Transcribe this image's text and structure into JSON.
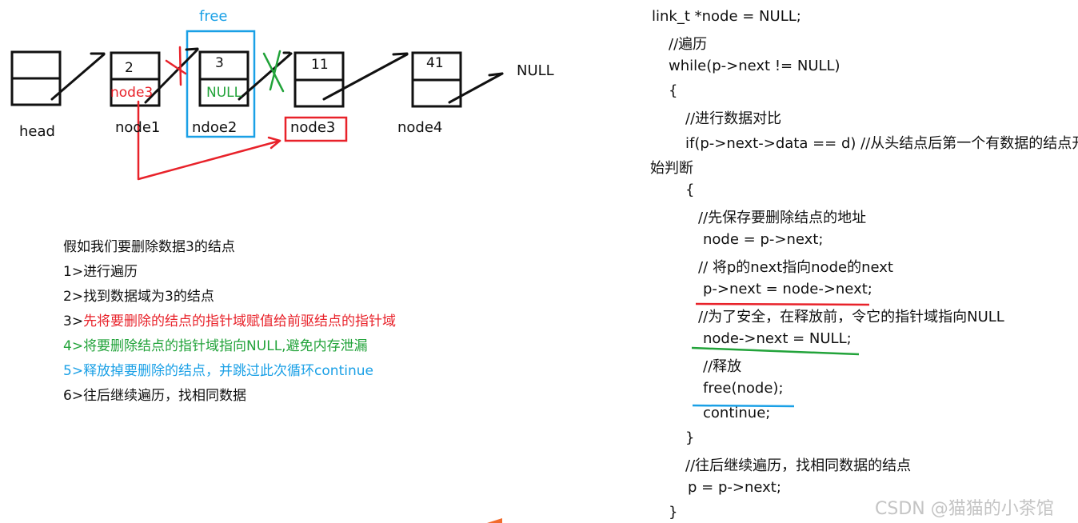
{
  "diagram": {
    "free_label": "free",
    "null_end_label": "NULL",
    "nodes": [
      {
        "name": "head",
        "data": "",
        "next_text": ""
      },
      {
        "name": "node1",
        "data": "2",
        "next_text": "node3"
      },
      {
        "name": "ndoe2",
        "data": "3",
        "next_text": "NULL"
      },
      {
        "name": "node3",
        "data": "11",
        "next_text": ""
      },
      {
        "name": "node4",
        "data": "41",
        "next_text": ""
      }
    ],
    "colors": {
      "red": "#e8222a",
      "green": "#22a33a",
      "blue": "#1aa0e6",
      "black": "#111111",
      "orange": "#f26b2c"
    }
  },
  "steps": {
    "intro": "假如我们要删除数据3的结点",
    "items": [
      {
        "prefix": "1>",
        "text": "进行遍历",
        "color": "black"
      },
      {
        "prefix": "2>",
        "text": "找到数据域为3的结点",
        "color": "black"
      },
      {
        "prefix": "3>",
        "text": "先将要删除的结点的指针域赋值给前驱结点的指针域",
        "color": "red"
      },
      {
        "prefix": "4>",
        "text": "将要删除结点的指针域指向NULL,避免内存泄漏",
        "color": "green"
      },
      {
        "prefix": "5>",
        "text": "释放掉要删除的结点，并跳过此次循环continue",
        "color": "blue"
      },
      {
        "prefix": "6>",
        "text": "往后继续遍历，找相同数据",
        "color": "black"
      }
    ]
  },
  "code": {
    "lines": [
      " link_t *node = NULL;",
      "//遍历",
      "while(p->next != NULL)",
      "{",
      "//进行数据对比",
      "if(p->next->data == d) //从头结点后第一个有数据的结点开",
      "始判断",
      "{",
      "//先保存要删除结点的地址",
      "node = p->next;",
      "// 将p的next指向node的next",
      "p->next = node->next;",
      "//为了安全，在释放前，令它的指针域指向NULL",
      "node->next = NULL;",
      "//释放",
      "free(node);",
      "continue;",
      "}",
      "//往后继续遍历，找相同数据的结点",
      "p = p->next;",
      "}"
    ]
  },
  "watermark": "CSDN @猫猫的小茶馆"
}
